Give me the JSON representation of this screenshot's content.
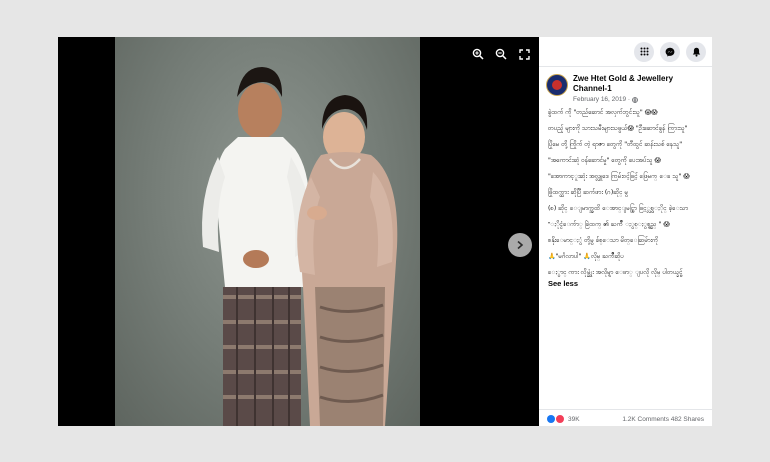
{
  "viewer": {
    "toolbar": {
      "zoom_in_icon": "zoom-in-icon",
      "zoom_out_icon": "zoom-out-icon",
      "fullscreen_icon": "fullscreen-icon"
    },
    "next_icon": "chevron-right-icon"
  },
  "panel": {
    "top_icons": [
      "grid-menu-icon",
      "messenger-icon",
      "bell-icon"
    ],
    "page_name": "Zwe Htet Gold & Jewellery Channel-1",
    "date": "February 16, 2019 ·",
    "privacy_icon": "globe-icon",
    "paragraphs": [
      "ခွဲထက် ကို \"တည်ဆောင် အလှက်ဘွင်းသူ\" 😱😱",
      "တပည့် များကို သားသမီးများသဖွယ်😱 \"ဦးဆောင်ခွန် ကြားသူ\"",
      "ပြိုမေ တို့ ကြိုက် တဲ့ ရာဇာ တွေကို \"တီထွင် ဆန်းသစ် နေသူ\"",
      "\"အကောင်းဆုံ ဝန်ဆောင်မှု\" တွေကို ပေးအပ်သူ 😱",
      "\"အောကာင့ူးဆုံး အလ္လူဒေ ကြမ်းဝင့်ဖြင့် ဖြေမက္ ေခ သူ\" 😱",
      "ဖြိုထက္ထား ဆိုပြီ ဆက်ဖား (ဂ)ဆိုင္ မွ",
      "(စ) ဆိုင္ ေျမာက္အထိ ေအာင္ျမင္စြာ ဖြင့္လွစ္ႏိုင္ ခဲ့ေသာ",
      "\"ႏိုင္ငံေက်ာ္ ခြဲထက္ ၏ ႀကိဳ ႏွစ္ႏွစ္ရွည္ \" 😱",
      "စနိုးေမာင္ႏွံ တို့မွ ခ်စ္ေသာ မိတ္ေဆြမ်ားကို",
      "🙏\"မင်္ဂလာပါ\" 🙏လိုမ္ ႀကိဳဆိုပ",
      "ေႏွာင္ ကား လိုမ္ဆုံး အလိုမ္ရာ ေဖာ္ ျပလို လိုမ္ ပါတယ္ခင္ဗ်"
    ],
    "see_less": "See less",
    "reactions": {
      "count": "39K",
      "stats": "1.2K Comments 482 Shares"
    }
  },
  "colors": {
    "viewer_bg": "#000000",
    "backdrop": "#e6e6e6",
    "next_button": "#c8c8c8"
  }
}
